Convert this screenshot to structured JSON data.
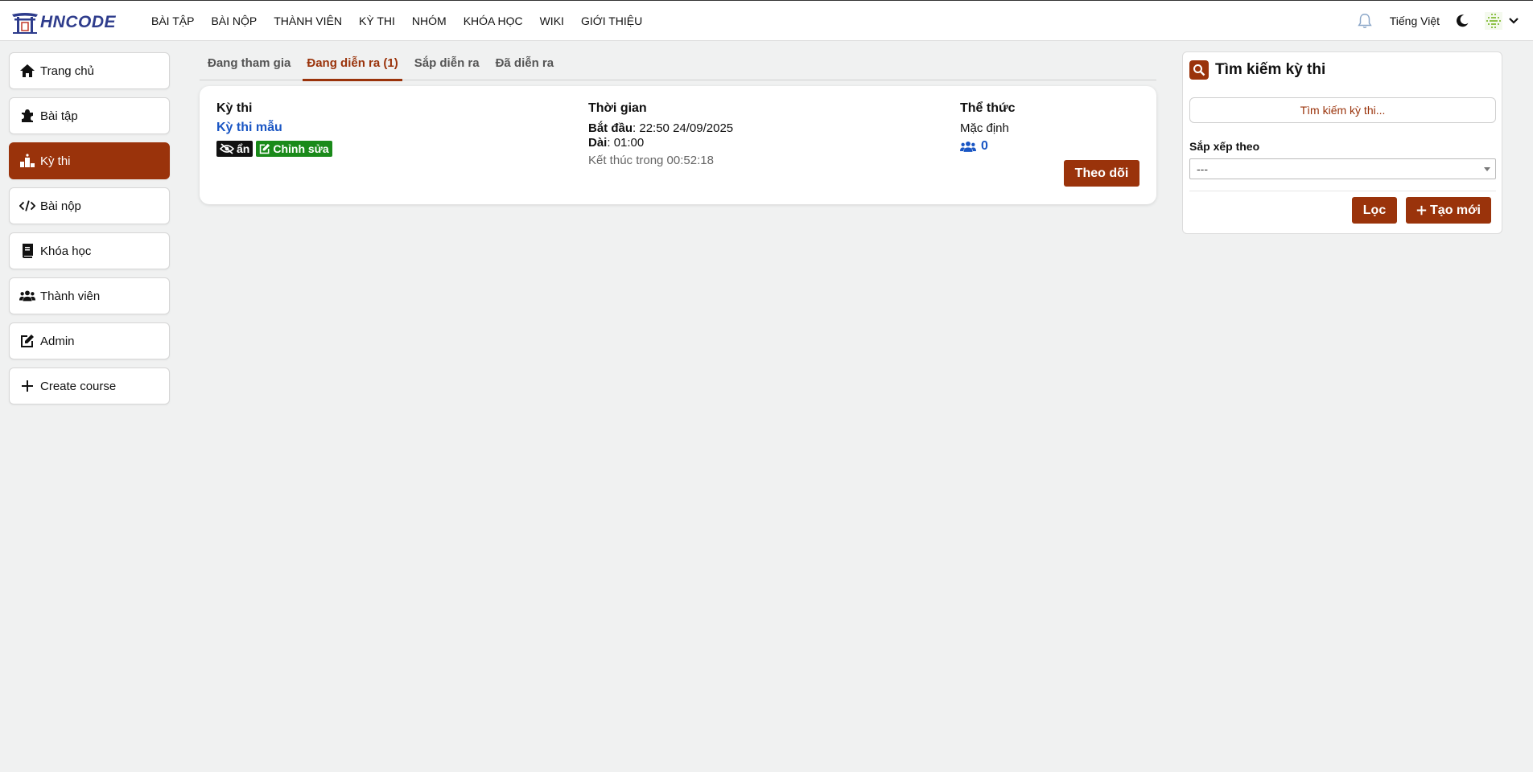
{
  "brand": {
    "logo_text": "HNCODE"
  },
  "nav": {
    "items": [
      "BÀI TẬP",
      "BÀI NỘP",
      "THÀNH VIÊN",
      "KỲ THI",
      "NHÓM",
      "KHÓA HỌC",
      "WIKI",
      "GIỚI THIỆU"
    ],
    "language": "Tiếng Việt"
  },
  "sidebar": {
    "items": [
      {
        "label": "Trang chủ",
        "icon": "home-icon"
      },
      {
        "label": "Bài tập",
        "icon": "puzzle-icon"
      },
      {
        "label": "Kỳ thi",
        "icon": "podium-icon",
        "active": true
      },
      {
        "label": "Bài nộp",
        "icon": "code-icon"
      },
      {
        "label": "Khóa học",
        "icon": "book-icon"
      },
      {
        "label": "Thành viên",
        "icon": "users-icon"
      },
      {
        "label": "Admin",
        "icon": "edit-icon"
      },
      {
        "label": "Create course",
        "icon": "plus-icon"
      }
    ]
  },
  "tabs": [
    "Đang tham gia",
    "Đang diễn ra (1)",
    "Sắp diễn ra",
    "Đã diễn ra"
  ],
  "active_tab": 1,
  "contest": {
    "col_contest": "Kỳ thi",
    "col_time": "Thời gian",
    "col_format": "Thể thức",
    "name": "Kỳ thi mẫu",
    "badge_hidden": "ẩn",
    "badge_edit": "Chỉnh sửa",
    "start_label": "Bắt đầu",
    "start_value": "22:50 24/09/2025",
    "length_label": "Dài",
    "length_value": "01:00",
    "ends_in": "Kết thúc trong 00:52:18",
    "format": "Mặc định",
    "participants": "0",
    "follow_button": "Theo dõi"
  },
  "search_panel": {
    "title": "Tìm kiếm kỳ thi",
    "placeholder": "Tìm kiếm kỳ thi...",
    "sort_label": "Sắp xếp theo",
    "sort_value": "---",
    "filter_button": "Lọc",
    "new_button": "Tạo mới"
  },
  "colors": {
    "accent": "#9a330b",
    "link": "#1a56c4",
    "edit_badge": "#1a8a1a"
  }
}
